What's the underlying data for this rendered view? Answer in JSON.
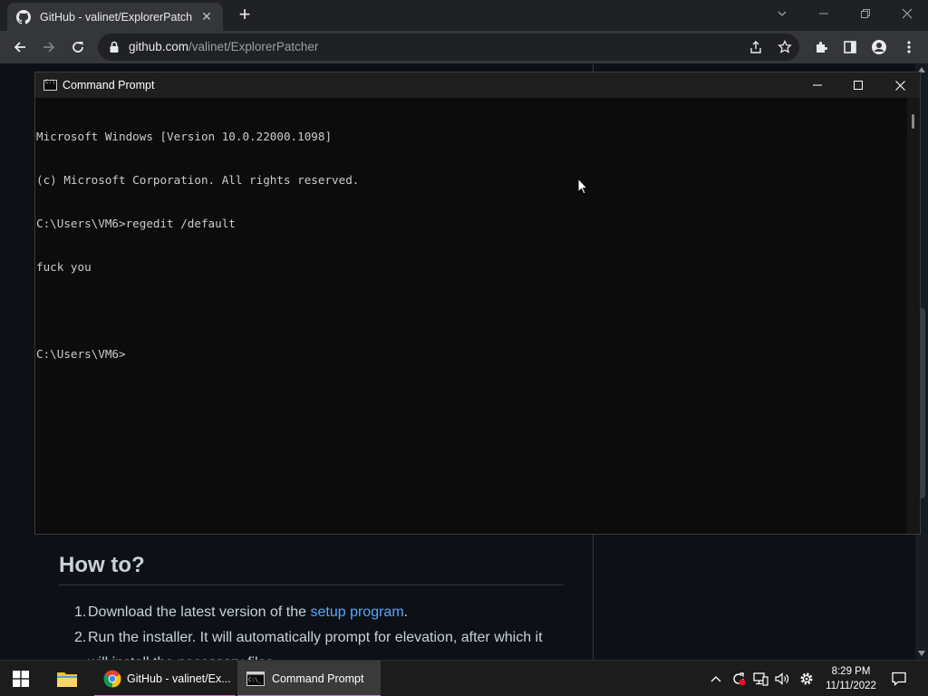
{
  "browser": {
    "tab": {
      "title": "GitHub - valinet/ExplorerPatcher",
      "close": "✕"
    },
    "new_tab": "+",
    "address": {
      "host": "github.com",
      "path": "/valinet/ExplorerPatcher"
    }
  },
  "page": {
    "heading": "How to?",
    "steps": [
      {
        "num": "1.",
        "text_before": "Download the latest version of the ",
        "link": "setup program",
        "text_after": "."
      },
      {
        "num": "2.",
        "text": "Run the installer. It will automatically prompt for elevation, after which it"
      },
      {
        "num": "",
        "text": "will install the necessary files"
      }
    ]
  },
  "cmd": {
    "title": "Command Prompt",
    "lines": [
      "Microsoft Windows [Version 10.0.22000.1098]",
      "(c) Microsoft Corporation. All rights reserved.",
      "C:\\Users\\VM6>regedit /default",
      "fuck you",
      "",
      "C:\\Users\\VM6>"
    ]
  },
  "taskbar": {
    "apps": [
      {
        "label": "GitHub - valinet/Ex...",
        "icon": "chrome-icon",
        "active": false
      },
      {
        "label": "Command Prompt",
        "icon": "cmd-icon",
        "active": true
      }
    ],
    "clock": {
      "time": "8:29 PM",
      "date": "11/11/2022"
    }
  },
  "colors": {
    "github_bg": "#0d1117",
    "link": "#58a6ff",
    "console_text": "#cccccc",
    "taskbar_active_underline": "#a68bc8",
    "taskbar_inactive_underline": "#c879c7"
  },
  "icons": [
    "github-icon",
    "back-arrow-icon",
    "forward-arrow-icon",
    "reload-icon",
    "lock-icon",
    "share-icon",
    "bookmark-star-icon",
    "extensions-icon",
    "side-panel-icon",
    "profile-icon",
    "menu-dots-icon",
    "start-icon",
    "file-explorer-icon",
    "chevron-up-icon",
    "sync-icon",
    "network-icon",
    "volume-icon",
    "settings-icon",
    "notification-icon"
  ]
}
